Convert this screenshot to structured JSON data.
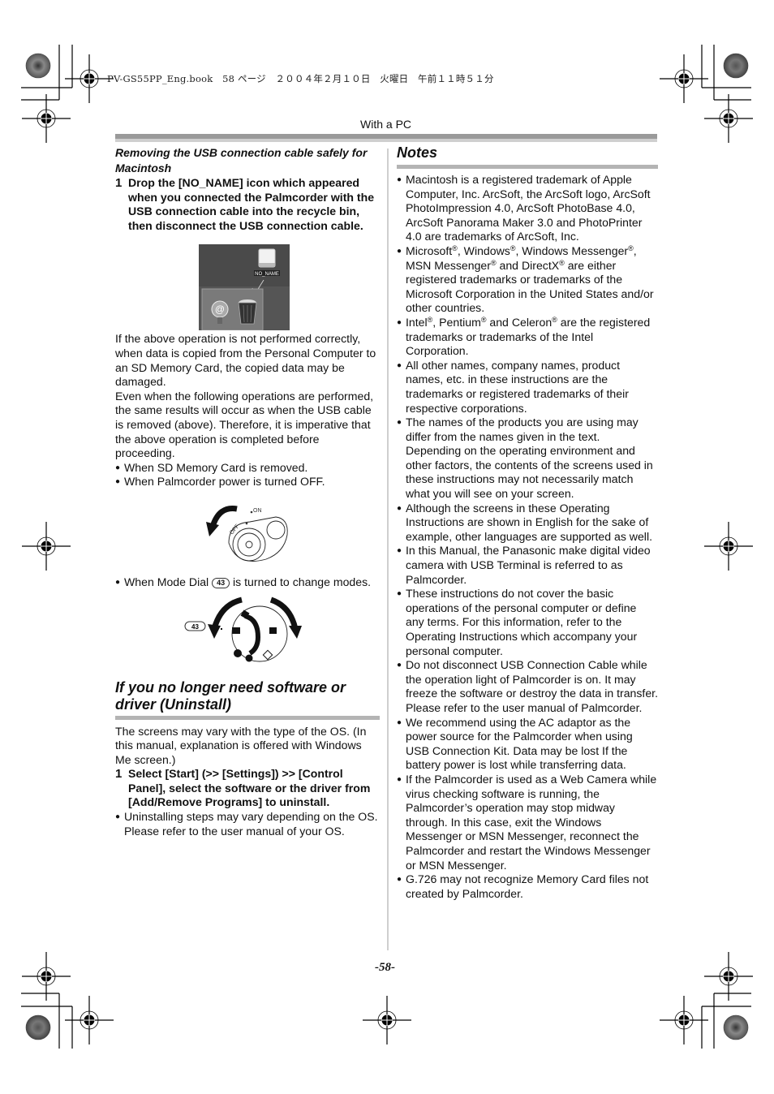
{
  "header": {
    "file_info": "PV-GS55PP_Eng.book　58 ページ　２００４年２月１０日　火曜日　午前１１時５１分",
    "section": "With a PC"
  },
  "left": {
    "mac_heading": "Removing the USB connection cable safely for Macintosh",
    "step1": {
      "num": "1",
      "text": "Drop the [NO_NAME] icon which appeared when you connected the Palmcorder with the USB connection cable into the recycle bin, then disconnect the USB connection cable."
    },
    "screenshot_label": "NO_NAME",
    "para1": "If the above operation is not performed correctly, when data is copied from the Personal Computer to an SD Memory Card, the copied data may be damaged.",
    "para2": "Even when the following operations are performed, the same results will occur as when the USB cable is removed (above). Therefore, it is imperative that the above operation is completed before proceeding.",
    "bullets": [
      "When SD Memory Card is removed.",
      "When Palmcorder power is turned OFF."
    ],
    "power_labels": {
      "off": "OFF",
      "on": "ON"
    },
    "mode_dial_bullet": {
      "before": "When Mode Dial",
      "ref": "43",
      "after": "is turned to change modes."
    },
    "dial_ref": "43",
    "uninstall_heading": "If you no longer need software or driver (Uninstall)",
    "uninstall_para": "The screens may vary with the type of the OS. (In this manual, explanation is offered with Windows Me screen.)",
    "uninstall_step": {
      "num": "1",
      "text": "Select [Start] (>> [Settings]) >> [Control Panel], select the software or the driver from [Add/Remove Programs] to uninstall."
    },
    "uninstall_bullet": "Uninstalling steps may vary depending on the OS. Please refer to the user manual of your OS."
  },
  "notes": {
    "title": "Notes",
    "items": [
      "Macintosh is a registered trademark of Apple Computer, Inc. ArcSoft, the ArcSoft logo, ArcSoft PhotoImpression 4.0, ArcSoft PhotoBase 4.0, ArcSoft Panorama Maker 3.0 and PhotoPrinter 4.0 are trademarks of ArcSoft, Inc.",
      "Microsoft®, Windows®, Windows Messenger®, MSN Messenger® and DirectX® are either registered trademarks or trademarks of the Microsoft Corporation in the United States and/or other countries.",
      "Intel®, Pentium® and Celeron® are the registered trademarks or trademarks of the Intel Corporation.",
      "All other names, company names, product names, etc. in these instructions are the trademarks or registered trademarks of their respective corporations.",
      "The names of the products you are using may differ from the names given in the text. Depending on the operating environment and other factors, the contents of the screens used in these instructions may not necessarily match what you will see on your screen.",
      "Although the screens in these Operating Instructions are shown in English for the sake of example, other languages are supported as well.",
      "In this Manual, the Panasonic make digital video camera with USB Terminal is referred to as Palmcorder.",
      "These instructions do not cover the basic operations of the personal computer or define any terms. For this information, refer to the Operating Instructions which accompany your personal computer.",
      "Do not disconnect USB Connection Cable while the operation light of Palmcorder is on. It may freeze the software or destroy the data in transfer. Please refer to the user manual of Palmcorder.",
      "We recommend using the AC adaptor as the power source for the Palmcorder when using USB Connection Kit. Data may be lost If the battery power is lost while transferring data.",
      "If the Palmcorder is used as a Web Camera while virus checking software is running, the Palmcorder’s operation may stop midway through. In this case, exit the Windows Messenger or MSN Messenger, reconnect the Palmcorder and restart the Windows Messenger or MSN Messenger.",
      "G.726 may not recognize Memory Card files not created by Palmcorder."
    ]
  },
  "footer": {
    "page_number": "-58-"
  },
  "icons": {
    "bullet": "●"
  }
}
